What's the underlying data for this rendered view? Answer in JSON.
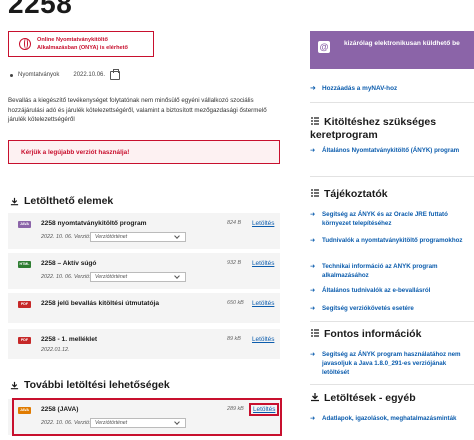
{
  "page": {
    "title": "2258",
    "online_notice": "Online Nyomtatványkitöltő Alkalmazásban (ONYA) is elérhető",
    "meta_category": "Nyomtatványok",
    "meta_date": "2022.10.06.",
    "description": "Bevallás a kiegészítő tevékenységet folytatónak nem minősülő egyéni vállalkozó szociális hozzájárulási adó és járulék kötelezettségéről, valamint a biztosított mezőgazdasági őstermelő járulék kötelezettségéről",
    "warning": "Kérjük a legújabb verziót használja!"
  },
  "downloads": {
    "title": "Letölthető elemek",
    "items": [
      {
        "badge": "JAVA",
        "badge_color": "#8b64a8",
        "name": "2258 nyomtatványkitöltő program",
        "sub": "2022. 10. 06. Verzió: 2.0",
        "version_button": "Verziótörténet",
        "size": "824 B",
        "link": "Letöltés"
      },
      {
        "badge": "HTML",
        "badge_color": "#2e7d32",
        "name": "2258 – Aktív súgó",
        "sub": "2022. 10. 06. Verzió: 2.0",
        "version_button": "Verziótörténet",
        "size": "932 B",
        "link": "Letöltés"
      },
      {
        "badge": "PDF",
        "badge_color": "#c62828",
        "name": "2258 jelű bevallás kitöltési útmutatója",
        "sub": "",
        "version_button": "",
        "size": "650 kB",
        "link": "Letöltés"
      },
      {
        "badge": "PDF",
        "badge_color": "#c62828",
        "name": "2258 - 1. melléklet",
        "sub": "2022.01.12.",
        "version_button": "",
        "size": "89 kB",
        "link": "Letöltés"
      }
    ]
  },
  "more_downloads": {
    "title": "További letöltési lehetőségek",
    "items": [
      {
        "badge": "JAVA",
        "badge_color": "#e07b00",
        "name": "2258 (JAVA)",
        "sub": "2022. 10. 06. Verzió: 2.0",
        "version_button": "Verziótörténet",
        "size": "289 kB",
        "link": "Letöltés"
      }
    ]
  },
  "sidebar": {
    "banner": "kizárólag elektronikusan küldhető be",
    "mynav_link": "Hozzáadás a myNAV-hoz",
    "section1": {
      "title": "Kitöltéshez szükséges keretprogram",
      "links": [
        "Általános Nyomtatványkitöltő (ÁNYK) program"
      ]
    },
    "section2": {
      "title": "Tájékoztatók",
      "links": [
        "Segítség az ÁNYK és az Oracle JRE futtató környezet telepítéséhez",
        "Tudnivalók a nyomtatványkitöltő programokhoz",
        "Technikai információ az ANYK program alkalmazásához",
        "Általános tudnivalók az e-bevallásról",
        "Segítség verziókövetés esetére"
      ]
    },
    "section3": {
      "title": "Fontos információk",
      "links": [
        "Segítség az ÁNYK program használatához nem javasoljuk a Java 1.8.0_291-es verziójának letöltését"
      ]
    },
    "section4": {
      "title": "Letöltések - egyéb",
      "links": [
        "Adatlapok, igazolások, meghatalmazásminták"
      ]
    }
  }
}
